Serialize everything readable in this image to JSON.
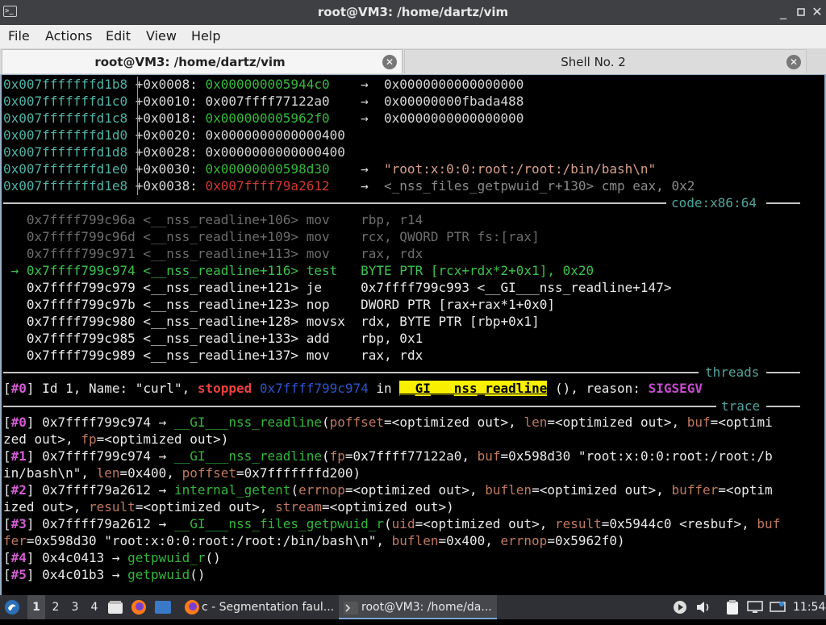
{
  "window": {
    "title": "root@VM3: /home/dartz/vim",
    "app_icon": "terminal-icon",
    "buttons": [
      "minimize-icon",
      "maximize-icon",
      "close-icon"
    ]
  },
  "menu": [
    "File",
    "Actions",
    "Edit",
    "View",
    "Help"
  ],
  "tabs": [
    {
      "label": "root@VM3: /home/dartz/vim",
      "active": true
    },
    {
      "label": "Shell No. 2",
      "active": false
    }
  ],
  "stack": [
    {
      "addr": "0x007fffffffd1b8",
      "off": "+0x0008:",
      "val": "0x000000005944c0",
      "val_color": "green",
      "arrow": "→",
      "deref": "0x0000000000000000",
      "deref_color": "plain"
    },
    {
      "addr": "0x007fffffffd1c0",
      "off": "+0x0010:",
      "val": "0x007ffff77122a0",
      "val_color": "plain",
      "arrow": "→",
      "deref": "0x00000000fbada488",
      "deref_color": "plain"
    },
    {
      "addr": "0x007fffffffd1c8",
      "off": "+0x0018:",
      "val": "0x000000005962f0",
      "val_color": "green",
      "arrow": "→",
      "deref": "0x0000000000000000",
      "deref_color": "plain"
    },
    {
      "addr": "0x007fffffffd1d0",
      "off": "+0x0020:",
      "val": "0x0000000000000400",
      "val_color": "plain",
      "arrow": "",
      "deref": "",
      "deref_color": "plain"
    },
    {
      "addr": "0x007fffffffd1d8",
      "off": "+0x0028:",
      "val": "0x0000000000000400",
      "val_color": "plain",
      "arrow": "",
      "deref": "",
      "deref_color": "plain"
    },
    {
      "addr": "0x007fffffffd1e0",
      "off": "+0x0030:",
      "val": "0x00000000598d30",
      "val_color": "green",
      "arrow": "→",
      "deref": "\"root:x:0:0:root:/root:/bin/bash\\n\"",
      "deref_color": "string"
    },
    {
      "addr": "0x007fffffffd1e8",
      "off": "+0x0038:",
      "val": "0x007ffff79a2612",
      "val_color": "red",
      "arrow": "→",
      "deref": "<_nss_files_getpwuid_r+130> cmp eax, 0x2",
      "deref_color": "grey"
    }
  ],
  "code_label": "code:x86:64",
  "code": [
    {
      "marker": "",
      "addr": "0x7ffff799c96a",
      "sym": "<__nss_readline+106>",
      "op": "mov",
      "args": "rbp, r14",
      "state": "past"
    },
    {
      "marker": "",
      "addr": "0x7ffff799c96d",
      "sym": "<__nss_readline+109>",
      "op": "mov",
      "args": "rcx, QWORD PTR fs:[rax]",
      "state": "past"
    },
    {
      "marker": "",
      "addr": "0x7ffff799c971",
      "sym": "<__nss_readline+113>",
      "op": "mov",
      "args": "rax, rdx",
      "state": "past"
    },
    {
      "marker": "→",
      "addr": "0x7ffff799c974",
      "sym": "<__nss_readline+116>",
      "op": "test",
      "args": "BYTE PTR [rcx+rdx*2+0x1], 0x20",
      "state": "current"
    },
    {
      "marker": "",
      "addr": "0x7ffff799c979",
      "sym": "<__nss_readline+121>",
      "op": "je",
      "args": "0x7ffff799c993 <__GI___nss_readline+147>",
      "state": "future"
    },
    {
      "marker": "",
      "addr": "0x7ffff799c97b",
      "sym": "<__nss_readline+123>",
      "op": "nop",
      "args": "DWORD PTR [rax+rax*1+0x0]",
      "state": "future"
    },
    {
      "marker": "",
      "addr": "0x7ffff799c980",
      "sym": "<__nss_readline+128>",
      "op": "movsx",
      "args": "rdx, BYTE PTR [rbp+0x1]",
      "state": "future"
    },
    {
      "marker": "",
      "addr": "0x7ffff799c985",
      "sym": "<__nss_readline+133>",
      "op": "add",
      "args": "rbp, 0x1",
      "state": "future"
    },
    {
      "marker": "",
      "addr": "0x7ffff799c989",
      "sym": "<__nss_readline+137>",
      "op": "mov",
      "args": "rax, rdx",
      "state": "future"
    }
  ],
  "threads_label": "threads",
  "thread": {
    "idx": "#0",
    "text_a": " Id 1, Name: \"curl\", ",
    "stopped": "stopped",
    "addr": "0x7ffff799c974",
    "in_text": " in ",
    "func": "__GI___nss_readline",
    "text_b": " (), reason: ",
    "reason": "SIGSEGV"
  },
  "trace_label": "trace",
  "trace_lines": [
    [
      [
        "b",
        "["
      ],
      [
        "m",
        "#0"
      ],
      [
        "b",
        "] 0x7ffff799c974 → "
      ],
      [
        "g",
        "__GI___nss_readline"
      ],
      [
        "b",
        "("
      ],
      [
        "p",
        "poffset"
      ],
      [
        "b",
        "=<optimized out>, "
      ],
      [
        "p",
        "len"
      ],
      [
        "b",
        "=<optimized out>, "
      ],
      [
        "p",
        "buf"
      ],
      [
        "b",
        "=<optimi"
      ]
    ],
    [
      [
        "b",
        "zed out>, "
      ],
      [
        "p",
        "fp"
      ],
      [
        "b",
        "=<optimized out>)"
      ]
    ],
    [
      [
        "b",
        "["
      ],
      [
        "m",
        "#1"
      ],
      [
        "b",
        "] 0x7ffff799c974 → "
      ],
      [
        "g",
        "__GI___nss_readline"
      ],
      [
        "b",
        "("
      ],
      [
        "p",
        "fp"
      ],
      [
        "b",
        "=0x7ffff77122a0, "
      ],
      [
        "p",
        "buf"
      ],
      [
        "b",
        "=0x598d30 \"root:x:0:0:root:/root:/b"
      ]
    ],
    [
      [
        "b",
        "in/bash\\n\", "
      ],
      [
        "p",
        "len"
      ],
      [
        "b",
        "=0x400, "
      ],
      [
        "p",
        "poffset"
      ],
      [
        "b",
        "=0x7fffffffd200)"
      ]
    ],
    [
      [
        "b",
        "["
      ],
      [
        "m",
        "#2"
      ],
      [
        "b",
        "] 0x7ffff79a2612 → "
      ],
      [
        "g",
        "internal_getent"
      ],
      [
        "b",
        "("
      ],
      [
        "p",
        "errnop"
      ],
      [
        "b",
        "=<optimized out>, "
      ],
      [
        "p",
        "buflen"
      ],
      [
        "b",
        "=<optimized out>, "
      ],
      [
        "p",
        "buffer"
      ],
      [
        "b",
        "=<optim"
      ]
    ],
    [
      [
        "b",
        "ized out>, "
      ],
      [
        "p",
        "result"
      ],
      [
        "b",
        "=<optimized out>, "
      ],
      [
        "p",
        "stream"
      ],
      [
        "b",
        "=<optimized out>)"
      ]
    ],
    [
      [
        "b",
        "["
      ],
      [
        "m",
        "#3"
      ],
      [
        "b",
        "] 0x7ffff79a2612 → "
      ],
      [
        "g",
        "__GI___nss_files_getpwuid_r"
      ],
      [
        "b",
        "("
      ],
      [
        "p",
        "uid"
      ],
      [
        "b",
        "=<optimized out>, "
      ],
      [
        "p",
        "result"
      ],
      [
        "b",
        "=0x5944c0 <resbuf>, "
      ],
      [
        "p",
        "buf"
      ]
    ],
    [
      [
        "p",
        "fer"
      ],
      [
        "b",
        "=0x598d30 \"root:x:0:0:root:/root:/bin/bash\\n\", "
      ],
      [
        "p",
        "buflen"
      ],
      [
        "b",
        "=0x400, "
      ],
      [
        "p",
        "errnop"
      ],
      [
        "b",
        "=0x5962f0)"
      ]
    ],
    [
      [
        "b",
        "["
      ],
      [
        "m",
        "#4"
      ],
      [
        "b",
        "] 0x4c0413 → "
      ],
      [
        "g",
        "getpwuid_r"
      ],
      [
        "b",
        "()"
      ]
    ],
    [
      [
        "b",
        "["
      ],
      [
        "m",
        "#5"
      ],
      [
        "b",
        "] 0x4c01b3 → "
      ],
      [
        "g",
        "getpwuid"
      ],
      [
        "b",
        "()"
      ]
    ]
  ],
  "taskbar": {
    "workspaces": [
      "1",
      "2",
      "3",
      "4"
    ],
    "tasks": [
      {
        "icon": "firefox-icon",
        "label": "c - Segmentation faul...",
        "active": false
      },
      {
        "icon": "terminal-icon",
        "label": "root@VM3: /home/da...",
        "active": true
      }
    ],
    "clock": "11:54"
  }
}
